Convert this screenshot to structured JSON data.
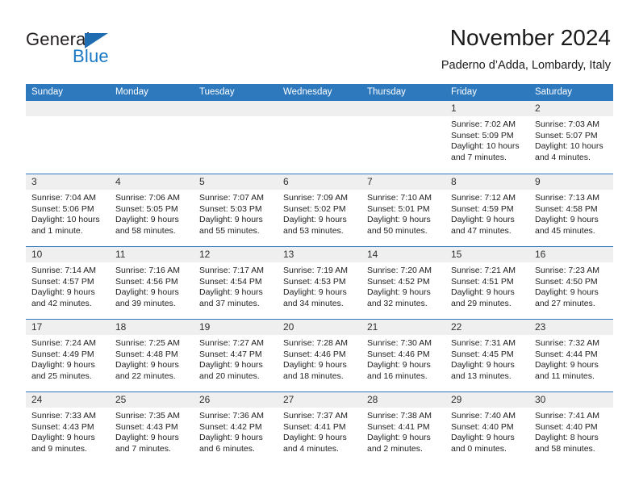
{
  "brand": {
    "name_part1": "General",
    "name_part2": "Blue",
    "icon": "triangle-logo",
    "accent_color": "#1878c4",
    "triangle_color": "#1f6cb0"
  },
  "header": {
    "title": "November 2024",
    "subtitle": "Paderno d’Adda, Lombardy, Italy"
  },
  "calendar": {
    "header_bg": "#2e78bd",
    "daynum_bg": "#efefef",
    "weekdays": [
      "Sunday",
      "Monday",
      "Tuesday",
      "Wednesday",
      "Thursday",
      "Friday",
      "Saturday"
    ],
    "weeks": [
      [
        {
          "day": "",
          "sunrise": "",
          "sunset": "",
          "daylight": ""
        },
        {
          "day": "",
          "sunrise": "",
          "sunset": "",
          "daylight": ""
        },
        {
          "day": "",
          "sunrise": "",
          "sunset": "",
          "daylight": ""
        },
        {
          "day": "",
          "sunrise": "",
          "sunset": "",
          "daylight": ""
        },
        {
          "day": "",
          "sunrise": "",
          "sunset": "",
          "daylight": ""
        },
        {
          "day": "1",
          "sunrise": "Sunrise: 7:02 AM",
          "sunset": "Sunset: 5:09 PM",
          "daylight": "Daylight: 10 hours and 7 minutes."
        },
        {
          "day": "2",
          "sunrise": "Sunrise: 7:03 AM",
          "sunset": "Sunset: 5:07 PM",
          "daylight": "Daylight: 10 hours and 4 minutes."
        }
      ],
      [
        {
          "day": "3",
          "sunrise": "Sunrise: 7:04 AM",
          "sunset": "Sunset: 5:06 PM",
          "daylight": "Daylight: 10 hours and 1 minute."
        },
        {
          "day": "4",
          "sunrise": "Sunrise: 7:06 AM",
          "sunset": "Sunset: 5:05 PM",
          "daylight": "Daylight: 9 hours and 58 minutes."
        },
        {
          "day": "5",
          "sunrise": "Sunrise: 7:07 AM",
          "sunset": "Sunset: 5:03 PM",
          "daylight": "Daylight: 9 hours and 55 minutes."
        },
        {
          "day": "6",
          "sunrise": "Sunrise: 7:09 AM",
          "sunset": "Sunset: 5:02 PM",
          "daylight": "Daylight: 9 hours and 53 minutes."
        },
        {
          "day": "7",
          "sunrise": "Sunrise: 7:10 AM",
          "sunset": "Sunset: 5:01 PM",
          "daylight": "Daylight: 9 hours and 50 minutes."
        },
        {
          "day": "8",
          "sunrise": "Sunrise: 7:12 AM",
          "sunset": "Sunset: 4:59 PM",
          "daylight": "Daylight: 9 hours and 47 minutes."
        },
        {
          "day": "9",
          "sunrise": "Sunrise: 7:13 AM",
          "sunset": "Sunset: 4:58 PM",
          "daylight": "Daylight: 9 hours and 45 minutes."
        }
      ],
      [
        {
          "day": "10",
          "sunrise": "Sunrise: 7:14 AM",
          "sunset": "Sunset: 4:57 PM",
          "daylight": "Daylight: 9 hours and 42 minutes."
        },
        {
          "day": "11",
          "sunrise": "Sunrise: 7:16 AM",
          "sunset": "Sunset: 4:56 PM",
          "daylight": "Daylight: 9 hours and 39 minutes."
        },
        {
          "day": "12",
          "sunrise": "Sunrise: 7:17 AM",
          "sunset": "Sunset: 4:54 PM",
          "daylight": "Daylight: 9 hours and 37 minutes."
        },
        {
          "day": "13",
          "sunrise": "Sunrise: 7:19 AM",
          "sunset": "Sunset: 4:53 PM",
          "daylight": "Daylight: 9 hours and 34 minutes."
        },
        {
          "day": "14",
          "sunrise": "Sunrise: 7:20 AM",
          "sunset": "Sunset: 4:52 PM",
          "daylight": "Daylight: 9 hours and 32 minutes."
        },
        {
          "day": "15",
          "sunrise": "Sunrise: 7:21 AM",
          "sunset": "Sunset: 4:51 PM",
          "daylight": "Daylight: 9 hours and 29 minutes."
        },
        {
          "day": "16",
          "sunrise": "Sunrise: 7:23 AM",
          "sunset": "Sunset: 4:50 PM",
          "daylight": "Daylight: 9 hours and 27 minutes."
        }
      ],
      [
        {
          "day": "17",
          "sunrise": "Sunrise: 7:24 AM",
          "sunset": "Sunset: 4:49 PM",
          "daylight": "Daylight: 9 hours and 25 minutes."
        },
        {
          "day": "18",
          "sunrise": "Sunrise: 7:25 AM",
          "sunset": "Sunset: 4:48 PM",
          "daylight": "Daylight: 9 hours and 22 minutes."
        },
        {
          "day": "19",
          "sunrise": "Sunrise: 7:27 AM",
          "sunset": "Sunset: 4:47 PM",
          "daylight": "Daylight: 9 hours and 20 minutes."
        },
        {
          "day": "20",
          "sunrise": "Sunrise: 7:28 AM",
          "sunset": "Sunset: 4:46 PM",
          "daylight": "Daylight: 9 hours and 18 minutes."
        },
        {
          "day": "21",
          "sunrise": "Sunrise: 7:30 AM",
          "sunset": "Sunset: 4:46 PM",
          "daylight": "Daylight: 9 hours and 16 minutes."
        },
        {
          "day": "22",
          "sunrise": "Sunrise: 7:31 AM",
          "sunset": "Sunset: 4:45 PM",
          "daylight": "Daylight: 9 hours and 13 minutes."
        },
        {
          "day": "23",
          "sunrise": "Sunrise: 7:32 AM",
          "sunset": "Sunset: 4:44 PM",
          "daylight": "Daylight: 9 hours and 11 minutes."
        }
      ],
      [
        {
          "day": "24",
          "sunrise": "Sunrise: 7:33 AM",
          "sunset": "Sunset: 4:43 PM",
          "daylight": "Daylight: 9 hours and 9 minutes."
        },
        {
          "day": "25",
          "sunrise": "Sunrise: 7:35 AM",
          "sunset": "Sunset: 4:43 PM",
          "daylight": "Daylight: 9 hours and 7 minutes."
        },
        {
          "day": "26",
          "sunrise": "Sunrise: 7:36 AM",
          "sunset": "Sunset: 4:42 PM",
          "daylight": "Daylight: 9 hours and 6 minutes."
        },
        {
          "day": "27",
          "sunrise": "Sunrise: 7:37 AM",
          "sunset": "Sunset: 4:41 PM",
          "daylight": "Daylight: 9 hours and 4 minutes."
        },
        {
          "day": "28",
          "sunrise": "Sunrise: 7:38 AM",
          "sunset": "Sunset: 4:41 PM",
          "daylight": "Daylight: 9 hours and 2 minutes."
        },
        {
          "day": "29",
          "sunrise": "Sunrise: 7:40 AM",
          "sunset": "Sunset: 4:40 PM",
          "daylight": "Daylight: 9 hours and 0 minutes."
        },
        {
          "day": "30",
          "sunrise": "Sunrise: 7:41 AM",
          "sunset": "Sunset: 4:40 PM",
          "daylight": "Daylight: 8 hours and 58 minutes."
        }
      ]
    ]
  }
}
